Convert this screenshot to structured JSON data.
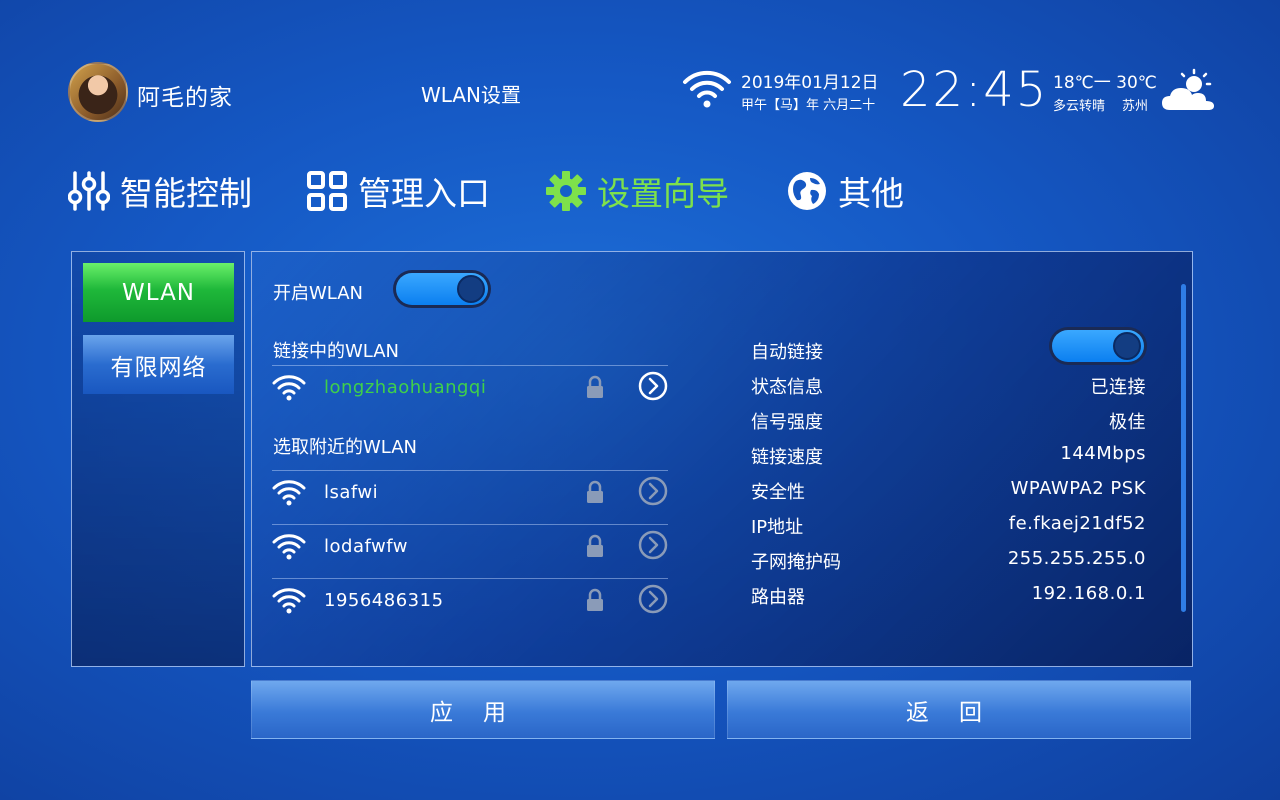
{
  "header": {
    "home_name": "阿毛的家",
    "page_title": "WLAN设置",
    "date": "2019年01月12日",
    "lunar_date": "甲午【马】年 六月二十",
    "time": "22:45",
    "temperature": "18℃一 30℃",
    "weather": "多云转晴",
    "city": "苏州"
  },
  "tabs": [
    {
      "label": "智能控制",
      "icon": "sliders-icon"
    },
    {
      "label": "管理入口",
      "icon": "grid-icon"
    },
    {
      "label": "设置向导",
      "icon": "gear-icon",
      "active": true
    },
    {
      "label": "其他",
      "icon": "globe-icon"
    }
  ],
  "sidebar": {
    "items": [
      {
        "label": "WLAN",
        "active": true
      },
      {
        "label": "有限网络"
      }
    ]
  },
  "wlan": {
    "enable_label": "开启WLAN",
    "enabled": true,
    "connected_section": "链接中的WLAN",
    "connected_ssid": "longzhaohuangqi",
    "nearby_section": "选取附近的WLAN",
    "nearby": [
      {
        "ssid": "lsafwi"
      },
      {
        "ssid": "lodafwfw"
      },
      {
        "ssid": "1956486315"
      }
    ]
  },
  "details": {
    "auto_connect_label": "自动链接",
    "auto_connect": true,
    "rows": [
      {
        "key": "状态信息",
        "value": "已连接"
      },
      {
        "key": "信号强度",
        "value": "极佳"
      },
      {
        "key": "链接速度",
        "value": "144Mbps"
      },
      {
        "key": "安全性",
        "value": "WPAWPA2 PSK"
      },
      {
        "key": "IP地址",
        "value": "fe.fkaej21df52"
      },
      {
        "key": "子网掩护码",
        "value": "255.255.255.0"
      },
      {
        "key": "路由器",
        "value": "192.168.0.1"
      }
    ]
  },
  "buttons": {
    "apply": "应用",
    "back": "返回"
  },
  "colors": {
    "active_tab": "#7ee14b",
    "connected_ssid": "#3fd04a",
    "toggle_on": "#1b8cf5",
    "sidebar_active": "#1fb83a"
  }
}
